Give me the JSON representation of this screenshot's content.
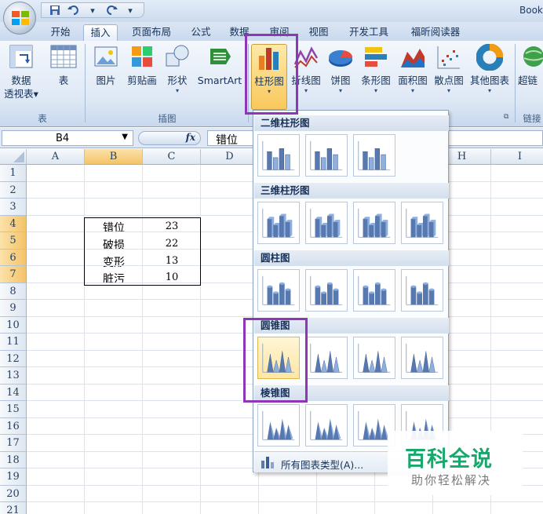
{
  "window": {
    "title": "Book"
  },
  "quick_access": {
    "save_icon": "save-icon",
    "undo_icon": "undo-icon",
    "redo_icon": "redo-icon",
    "customize": "▾"
  },
  "tabs": [
    {
      "label": "开始"
    },
    {
      "label": "插入"
    },
    {
      "label": "页面布局"
    },
    {
      "label": "公式"
    },
    {
      "label": "数据"
    },
    {
      "label": "审阅"
    },
    {
      "label": "视图"
    },
    {
      "label": "开发工具"
    },
    {
      "label": "福昕阅读器"
    }
  ],
  "active_tab": "插入",
  "ribbon": {
    "groups": [
      {
        "label": "表"
      },
      {
        "label": "插图"
      },
      {
        "label": "图表"
      },
      {
        "label": "链接"
      }
    ],
    "buttons": {
      "pivot_1": "数据",
      "pivot_2": "透视表",
      "table": "表",
      "picture": "图片",
      "clipart": "剪贴画",
      "shapes": "形状",
      "smartart": "SmartArt",
      "column": "柱形图",
      "line": "折线图",
      "pie": "饼图",
      "bar": "条形图",
      "area": "面积图",
      "scatter": "散点图",
      "other": "其他图表",
      "hyperlink": "超链"
    }
  },
  "formula_bar": {
    "name_box": "B4",
    "fx_label": "fx",
    "formula": "错位"
  },
  "columns": [
    "A",
    "B",
    "C",
    "D",
    "E",
    "F",
    "G",
    "H",
    "I"
  ],
  "rows": [
    "1",
    "2",
    "3",
    "4",
    "5",
    "6",
    "7",
    "8",
    "9",
    "10",
    "11",
    "12",
    "13",
    "14",
    "15",
    "16",
    "17",
    "18",
    "19",
    "20",
    "21"
  ],
  "cells": [
    {
      "label": "错位",
      "value": "23"
    },
    {
      "label": "破损",
      "value": "22"
    },
    {
      "label": "变形",
      "value": "13"
    },
    {
      "label": "脏污",
      "value": "10"
    }
  ],
  "dropdown": {
    "sections": [
      "二维柱形图",
      "三维柱形图",
      "圆柱图",
      "圆锥图",
      "棱锥图"
    ],
    "footer": "所有图表类型(A)..."
  },
  "colors": {
    "highlight": "#8e35b8",
    "accent": "#17a86b"
  },
  "watermark": {
    "title": "百科全说",
    "subtitle": "助你轻松解决"
  }
}
